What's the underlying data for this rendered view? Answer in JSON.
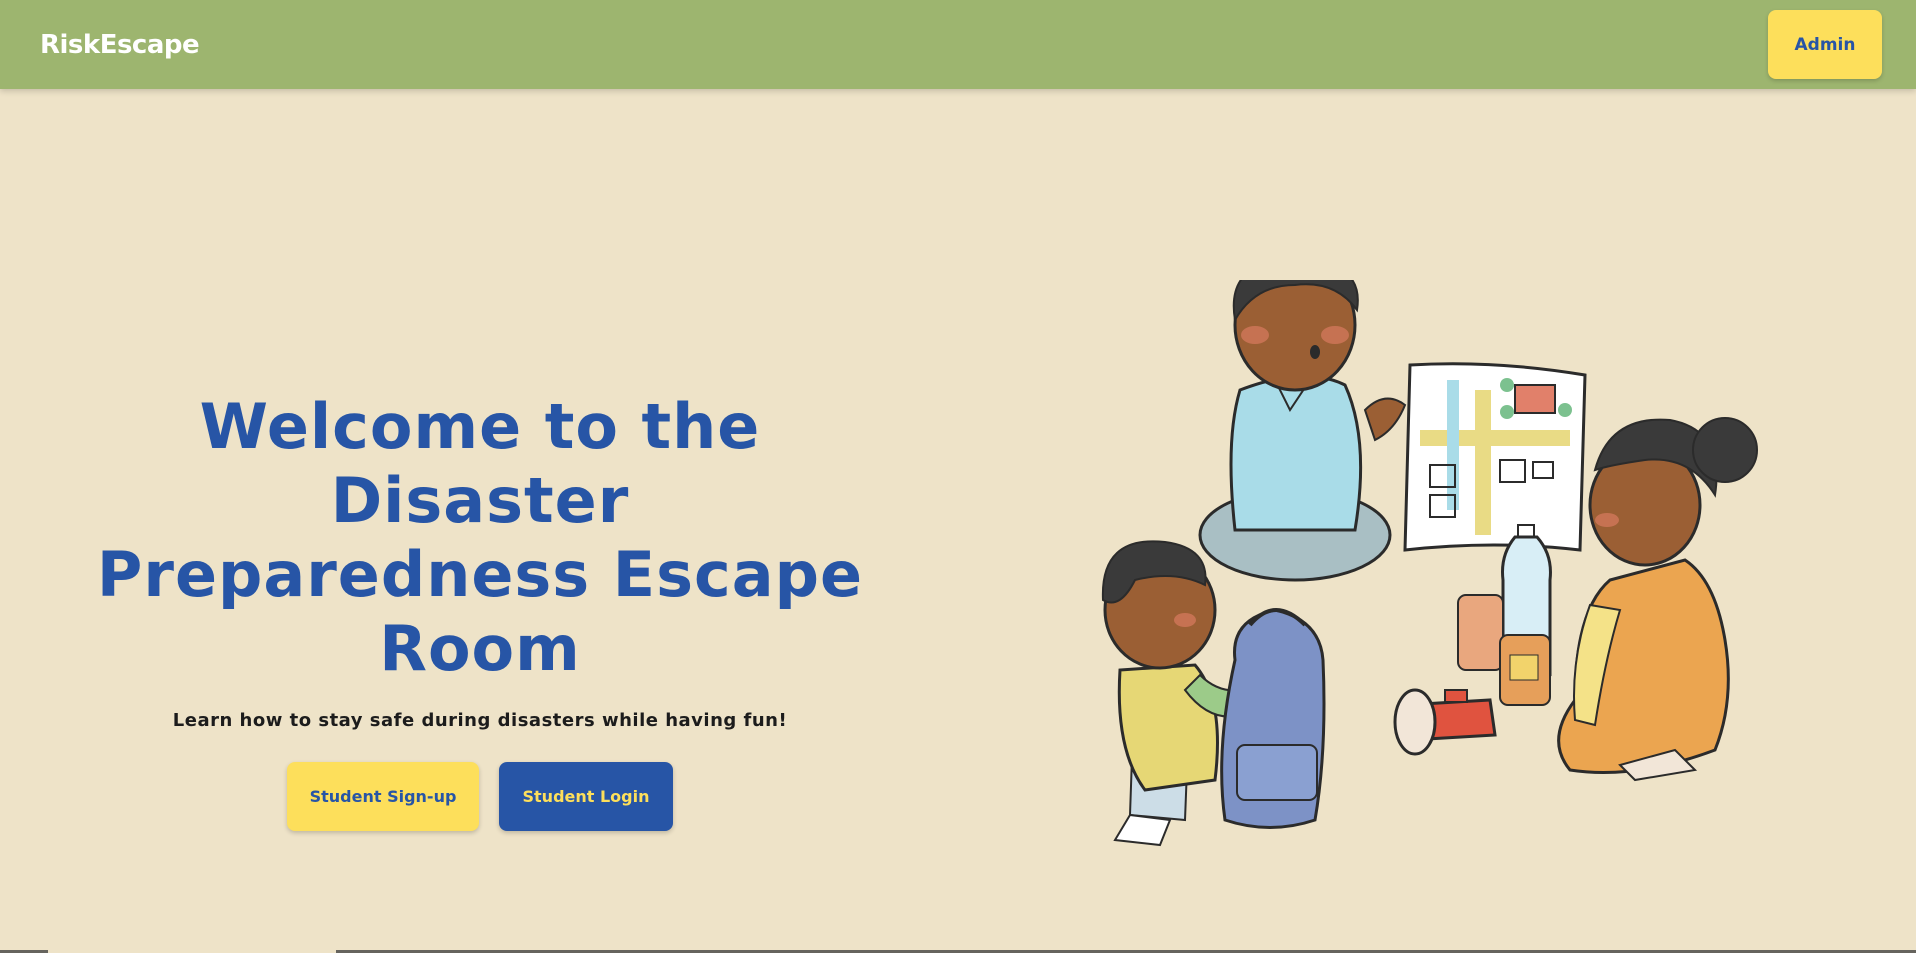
{
  "navbar": {
    "brand": "RiskEscape",
    "admin_label": "Admin"
  },
  "hero": {
    "title_line1": "Welcome to the Disaster",
    "title_line2": "Preparedness Escape",
    "title_line3": "Room",
    "subtitle": "Learn how to stay safe during disasters while having fun!",
    "signup_label": "Student Sign-up",
    "login_label": "Student Login"
  },
  "colors": {
    "navbar_bg": "#9DB56F",
    "page_bg": "#EEE3C8",
    "primary_blue": "#2755A6",
    "accent_yellow": "#FDDF5B"
  },
  "illustration": {
    "icon": "family-preparedness-illustration"
  }
}
